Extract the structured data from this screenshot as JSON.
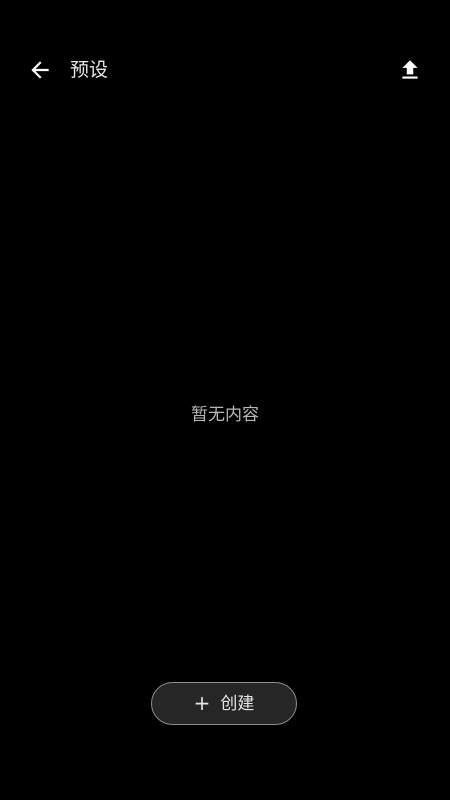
{
  "header": {
    "back_icon": "arrow-left-icon",
    "title": "预设",
    "upload_icon": "upload-icon"
  },
  "main": {
    "empty_text": "暂无内容"
  },
  "footer": {
    "create_icon": "plus-icon",
    "create_plus": "+",
    "create_label": "创建"
  },
  "colors": {
    "background": "#000000",
    "title": "#e8e8e8",
    "empty_text": "#b8b8b8",
    "button_border": "#8c8c8c",
    "button_fill": "#262626"
  }
}
